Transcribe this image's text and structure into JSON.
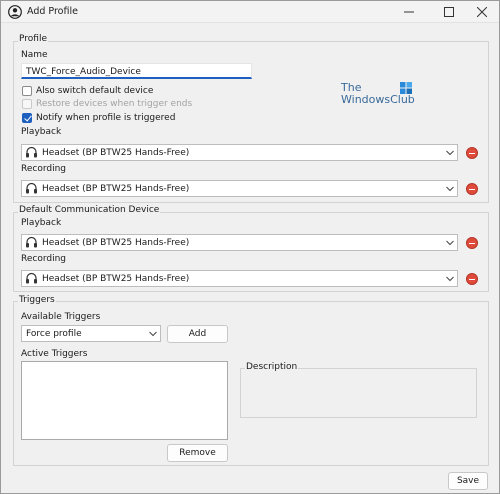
{
  "window": {
    "title": "Add Profile",
    "controls": {
      "minimize": "minimize",
      "maximize": "maximize",
      "close": "close"
    }
  },
  "profile": {
    "group_title": "Profile",
    "name_label": "Name",
    "name_value": "TWC_Force_Audio_Device",
    "also_switch_default": {
      "label": "Also switch default device",
      "checked": false
    },
    "restore_devices": {
      "label": "Restore devices when trigger ends",
      "checked": false,
      "disabled": true
    },
    "notify_triggered": {
      "label": "Notify when profile is triggered",
      "checked": true
    },
    "playback_label": "Playback",
    "playback_device": "Headset (BP BTW25 Hands-Free)",
    "recording_label": "Recording",
    "recording_device": "Headset (BP BTW25 Hands-Free)"
  },
  "logo": {
    "line1": "The",
    "line2": "WindowsClub",
    "accent": "#1f7fd1"
  },
  "communication": {
    "group_title": "Default Communication Device",
    "playback_label": "Playback",
    "playback_device": "Headset (BP BTW25 Hands-Free)",
    "recording_label": "Recording",
    "recording_device": "Headset (BP BTW25 Hands-Free)"
  },
  "triggers": {
    "group_title": "Triggers",
    "available_label": "Available Triggers",
    "selected_trigger": "Force profile",
    "add_label": "Add",
    "active_label": "Active Triggers",
    "description_label": "Description",
    "remove_label": "Remove"
  },
  "footer": {
    "save_label": "Save"
  },
  "colors": {
    "accent": "#1f5fbf",
    "remove_red": "#e04a3a",
    "window_bg": "#f0f0f0"
  },
  "icons": [
    "user-icon",
    "headset-device-icon",
    "chevron-down-icon",
    "remove-device-icon",
    "windows-logo-icon"
  ]
}
